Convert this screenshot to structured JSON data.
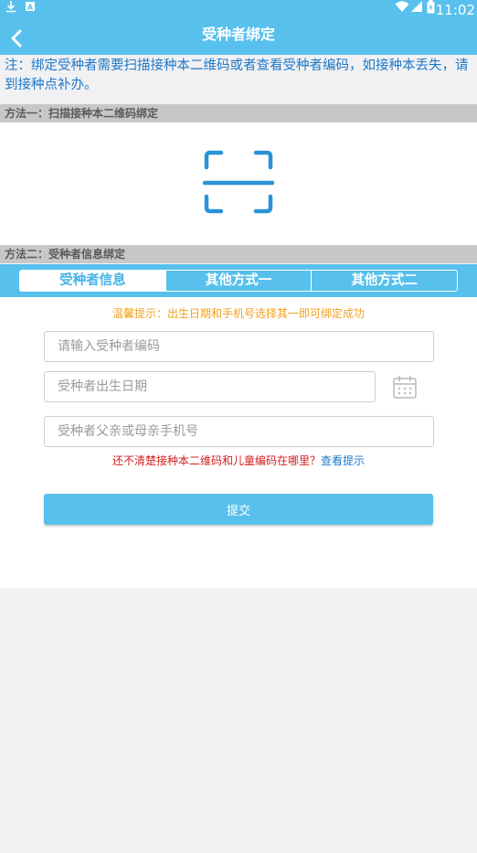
{
  "statusbar": {
    "time": "11:02",
    "icons": [
      "download-icon",
      "a-icon",
      "wifi-icon",
      "signal-icon",
      "battery-icon"
    ]
  },
  "header": {
    "title": "受种者绑定"
  },
  "notice": {
    "text": "注：绑定受种者需要扫描接种本二维码或者查看受种者编码，如接种本丢失，请到接种点补办。"
  },
  "method1": {
    "label": "方法一：扫描接种本二维码绑定"
  },
  "method2": {
    "label": "方法二：受种者信息绑定"
  },
  "tabs": [
    {
      "label": "受种者信息",
      "active": true
    },
    {
      "label": "其他方式一",
      "active": false
    },
    {
      "label": "其他方式二",
      "active": false
    }
  ],
  "form": {
    "tip": "温馨提示：出生日期和手机号选择其一即可绑定成功",
    "code_placeholder": "请输入受种者编码",
    "birth_placeholder": "受种者出生日期",
    "phone_placeholder": "受种者父亲或母亲手机号",
    "help_text": "还不清楚接种本二维码和儿童编码在哪里？",
    "help_link": "查看提示",
    "submit_label": "提交"
  },
  "colors": {
    "primary": "#58c0ec",
    "notice": "#1e78c8",
    "tip": "#f0a020",
    "warn": "#d21e1e",
    "background": "#f1f1f3"
  }
}
